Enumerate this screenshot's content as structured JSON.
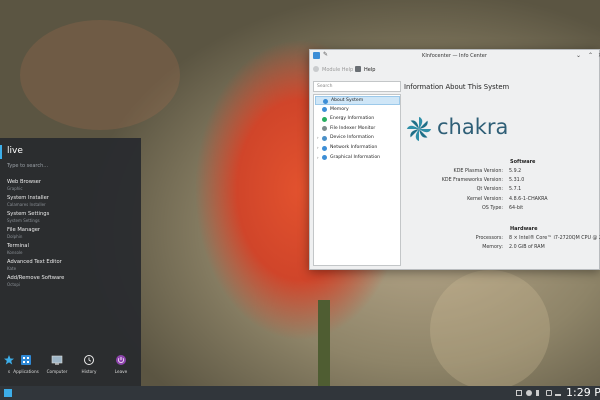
{
  "launcher": {
    "user": "live",
    "search_placeholder": "Type to search...",
    "items": [
      {
        "title": "Web Browser",
        "subtitle": "Graphic"
      },
      {
        "title": "System Installer",
        "subtitle": "Calamares Installer"
      },
      {
        "title": "System Settings",
        "subtitle": "System Settings"
      },
      {
        "title": "File Manager",
        "subtitle": "Dolphin"
      },
      {
        "title": "Terminal",
        "subtitle": "Konsole"
      },
      {
        "title": "Advanced Text Editor",
        "subtitle": "Kate"
      },
      {
        "title": "Add/Remove Software",
        "subtitle": "Octopi"
      }
    ],
    "tabs": [
      {
        "label": "s",
        "icon": "star-icon"
      },
      {
        "label": "Applications",
        "icon": "applications-icon"
      },
      {
        "label": "Computer",
        "icon": "computer-icon"
      },
      {
        "label": "History",
        "icon": "history-icon"
      },
      {
        "label": "Leave",
        "icon": "leave-icon"
      }
    ]
  },
  "window": {
    "title": "KInfocenter — Info Center",
    "toolbar": {
      "module_help": "Module Help",
      "help": "Help"
    },
    "search_placeholder": "Search",
    "tree": [
      {
        "label": "About System",
        "selected": true,
        "expandable": false,
        "color": "#3d8ed6"
      },
      {
        "label": "Memory",
        "selected": false,
        "expandable": false,
        "color": "#3d8ed6"
      },
      {
        "label": "Energy Information",
        "selected": false,
        "expandable": false,
        "color": "#27ae60"
      },
      {
        "label": "File Indexer Monitor",
        "selected": false,
        "expandable": false,
        "color": "#7f8c8d"
      },
      {
        "label": "Device Information",
        "selected": false,
        "expandable": true,
        "color": "#4a90c8"
      },
      {
        "label": "Network Information",
        "selected": false,
        "expandable": true,
        "color": "#3d8ed6"
      },
      {
        "label": "Graphical Information",
        "selected": false,
        "expandable": true,
        "color": "#3d8ed6"
      }
    ],
    "content": {
      "heading": "Information About This System",
      "logo_text": "chakra",
      "software_title": "Software",
      "software": [
        {
          "key": "KDE Plasma Version:",
          "value": "5.9.2"
        },
        {
          "key": "KDE Frameworks Version:",
          "value": "5.31.0"
        },
        {
          "key": "Qt Version:",
          "value": "5.7.1"
        },
        {
          "key": "Kernel Version:",
          "value": "4.8.6-1-CHAKRA"
        },
        {
          "key": "OS Type:",
          "value": "64-bit"
        }
      ],
      "hardware_title": "Hardware",
      "hardware": [
        {
          "key": "Processors:",
          "value": "8 × Intel® Core™ i7-2720QM CPU @ 2.20GHz"
        },
        {
          "key": "Memory:",
          "value": "2.0 GiB of RAM"
        }
      ]
    }
  },
  "taskbar": {
    "clock": "1:29 P"
  },
  "colors": {
    "accent": "#3daee9",
    "panel": "#31363b",
    "chakra": "#2f5f77"
  }
}
